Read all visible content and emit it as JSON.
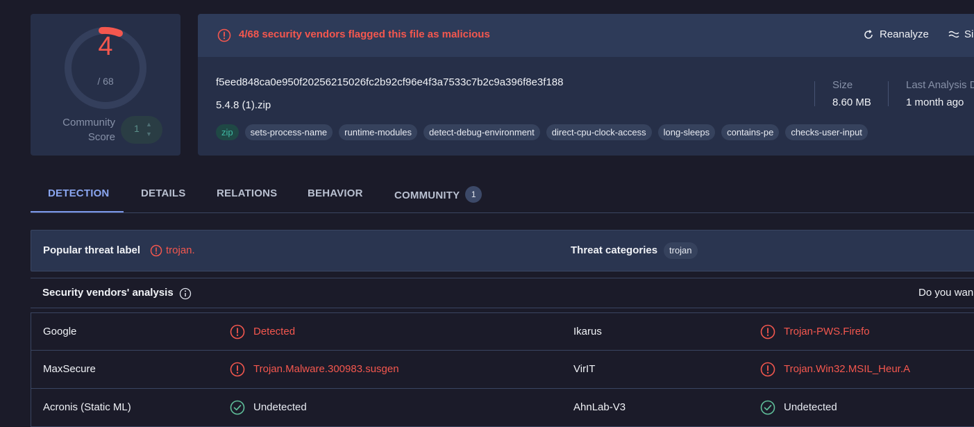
{
  "score": {
    "detections": "4",
    "total": "/ 68",
    "community_label": "Community Score",
    "community_value": "1"
  },
  "alert": {
    "text": "4/68 security vendors flagged this file as malicious",
    "reanalyze_label": "Reanalyze",
    "similar_label": "Si"
  },
  "file": {
    "hash": "f5eed848ca0e950f20256215026fc2b92cf96e4f3a7533c7b2c9a396f8e3f188",
    "name": "5.4.8 (1).zip",
    "tags": [
      "zip",
      "sets-process-name",
      "runtime-modules",
      "detect-debug-environment",
      "direct-cpu-clock-access",
      "long-sleeps",
      "contains-pe",
      "checks-user-input"
    ],
    "size_label": "Size",
    "size_value": "8.60 MB",
    "last_analysis_label": "Last Analysis D",
    "last_analysis_value": "1 month ago"
  },
  "tabs": [
    {
      "label": "DETECTION",
      "active": true
    },
    {
      "label": "DETAILS"
    },
    {
      "label": "RELATIONS"
    },
    {
      "label": "BEHAVIOR"
    },
    {
      "label": "COMMUNITY",
      "badge": "1"
    }
  ],
  "threat": {
    "popular_label_title": "Popular threat label",
    "popular_label_value": "trojan.",
    "categories_title": "Threat categories",
    "category": "trojan"
  },
  "vendors": {
    "title": "Security vendors' analysis",
    "cta": "Do you wan",
    "rows": [
      {
        "left_name": "Google",
        "left_result": "Detected",
        "left_status": "detected",
        "right_name": "Ikarus",
        "right_result": "Trojan-PWS.Firefo",
        "right_status": "detected"
      },
      {
        "left_name": "MaxSecure",
        "left_result": "Trojan.Malware.300983.susgen",
        "left_status": "detected",
        "right_name": "VirIT",
        "right_result": "Trojan.Win32.MSIL_Heur.A",
        "right_status": "detected"
      },
      {
        "left_name": "Acronis (Static ML)",
        "left_result": "Undetected",
        "left_status": "undetected",
        "right_name": "AhnLab-V3",
        "right_result": "Undetected",
        "right_status": "undetected"
      }
    ]
  },
  "colors": {
    "malicious": "#f4574e",
    "accent": "#8aa6f0",
    "background": "#1b1b29",
    "card": "#262f48",
    "clean": "#5fbf9a"
  },
  "icons": {
    "alert": "alert-circle-icon",
    "reanalyze": "refresh-icon",
    "similar": "similar-icon",
    "info": "info-icon",
    "detected": "alert-circle-icon",
    "undetected": "check-circle-icon"
  }
}
